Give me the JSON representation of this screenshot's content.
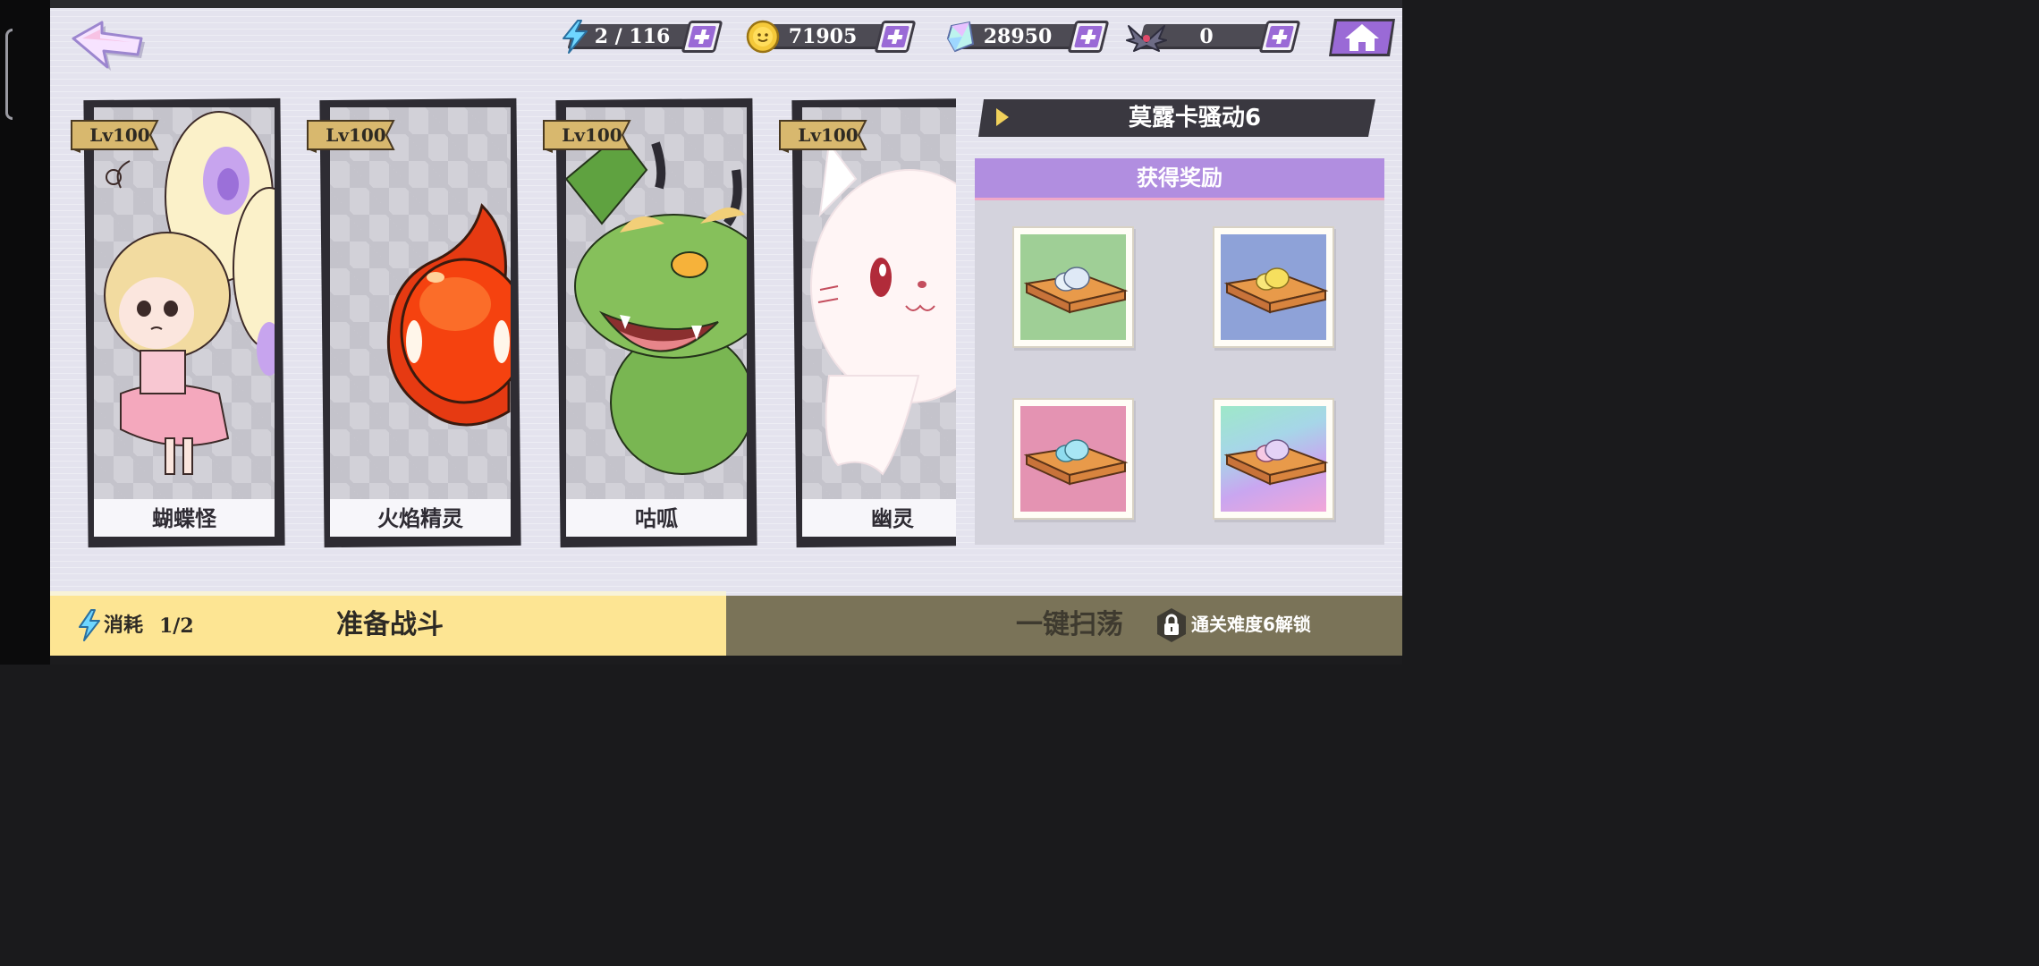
{
  "resources": {
    "energy": {
      "value": "2 / 116",
      "icon": "lightning-icon"
    },
    "coins": {
      "value": "71905",
      "icon": "coin-icon"
    },
    "crystals": {
      "value": "28950",
      "icon": "crystal-icon"
    },
    "tickets": {
      "value": "0",
      "icon": "bat-wing-icon"
    }
  },
  "cards": [
    {
      "level": "Lv100",
      "name": "蝴蝶怪"
    },
    {
      "level": "Lv100",
      "name": "火焰精灵"
    },
    {
      "level": "Lv100",
      "name": "咕呱"
    },
    {
      "level": "Lv100",
      "name": "幽灵"
    }
  ],
  "stage": {
    "title": "莫露卡骚动6"
  },
  "rewards": {
    "header": "获得奖励",
    "items": [
      {
        "icon": "biscuit-green-icon",
        "color": "#9fcf96"
      },
      {
        "icon": "biscuit-blue-icon",
        "color": "#8ea2d8"
      },
      {
        "icon": "biscuit-pink-icon",
        "color": "#e493b2"
      },
      {
        "icon": "biscuit-rainbow-icon",
        "color": "#a6d6e8"
      }
    ]
  },
  "bottom": {
    "cost_label": "消耗",
    "cost_value": "1/2",
    "prepare_label": "准备战斗",
    "sweep_label": "一键扫荡",
    "unlock_hint": "通关难度6解锁"
  },
  "colors": {
    "accent_purple": "#9a6ad6",
    "bottom_yellow": "#fde593",
    "bottom_olive": "#7a7358"
  }
}
